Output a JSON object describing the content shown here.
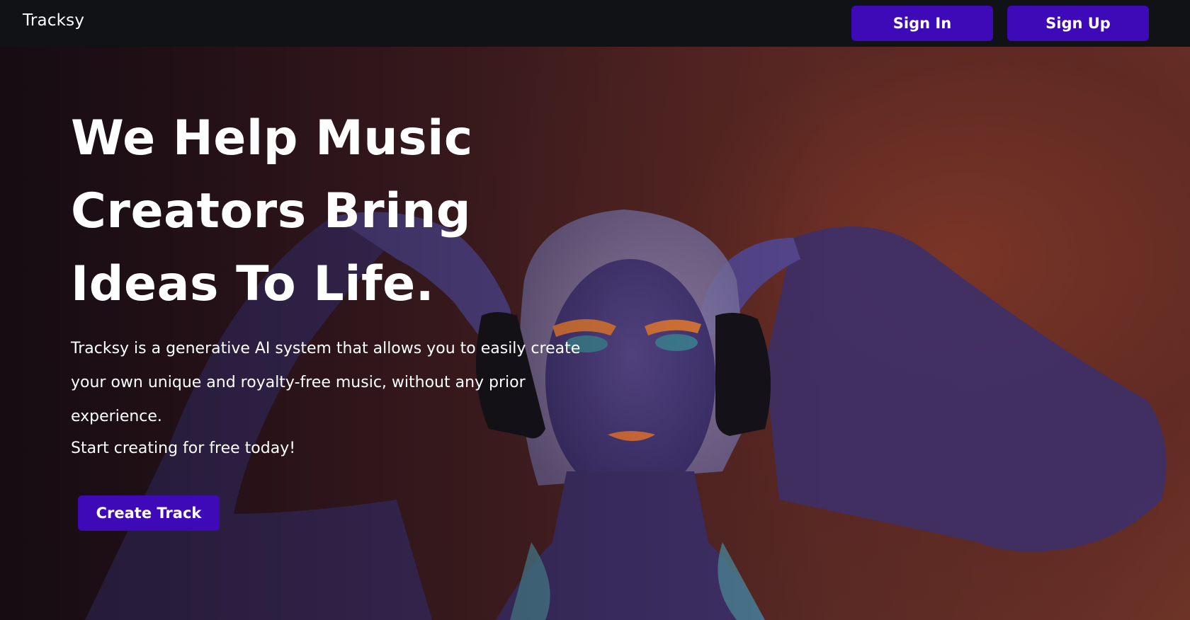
{
  "navbar": {
    "brand": "Tracksy",
    "sign_in_label": "Sign In",
    "sign_up_label": "Sign Up"
  },
  "hero": {
    "title": "We Help Music Creators Bring Ideas To Life.",
    "description": "Tracksy is a generative AI system that allows you to easily create your own unique and royalty-free music, without any prior experience.",
    "cta_text": "Start creating for free today!",
    "create_button_label": "Create Track"
  },
  "colors": {
    "navbar_bg": "#111216",
    "button_bg": "#3e0ab8",
    "text": "#ffffff",
    "hero_warm": "#7a3527"
  }
}
